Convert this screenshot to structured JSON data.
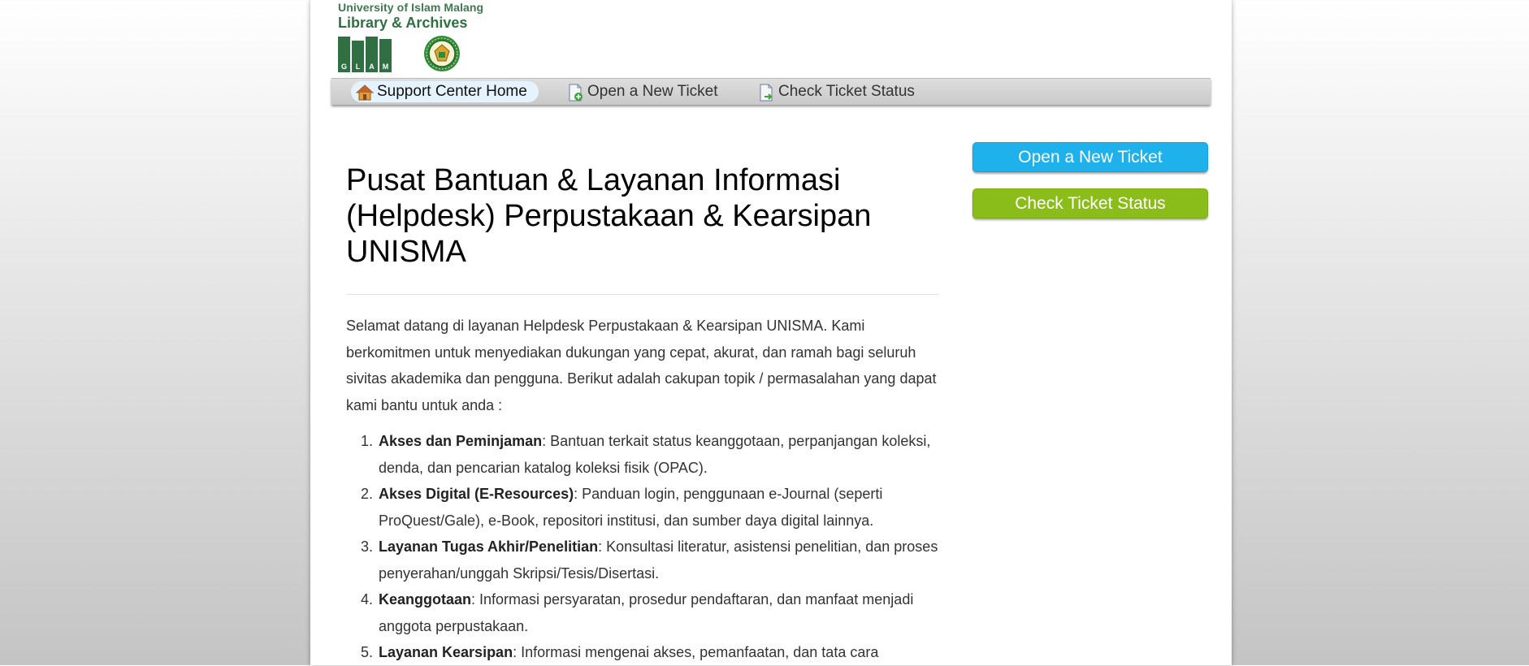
{
  "logo": {
    "line1": "University of Islam Malang",
    "line2": "Library & Archives",
    "glam_letters": [
      "G",
      "L",
      "A",
      "M"
    ],
    "brand_color": "#2f6f41"
  },
  "nav": {
    "items": [
      {
        "label": "Support Center Home",
        "icon": "home-icon",
        "active": true
      },
      {
        "label": "Open a New Ticket",
        "icon": "new-ticket-icon",
        "active": false
      },
      {
        "label": "Check Ticket Status",
        "icon": "ticket-status-icon",
        "active": false
      }
    ]
  },
  "main": {
    "title": "Pusat Bantuan & Layanan Informasi (Helpdesk) Perpustakaan & Kearsipan UNISMA",
    "intro": "Selamat datang di layanan Helpdesk Perpustakaan & Kearsipan UNISMA. Kami berkomitmen untuk menyediakan dukungan yang cepat, akurat, dan ramah bagi seluruh sivitas akademika dan pengguna. Berikut adalah cakupan topik / permasalahan yang dapat kami bantu untuk anda :",
    "topics": [
      {
        "term": "Akses dan Peminjaman",
        "desc": ": Bantuan terkait status keanggotaan, perpanjangan koleksi, denda, dan pencarian katalog koleksi fisik (OPAC)."
      },
      {
        "term": "Akses Digital (E-Resources)",
        "desc": ": Panduan login, penggunaan e-Journal (seperti ProQuest/Gale), e-Book, repositori institusi, dan sumber daya digital lainnya."
      },
      {
        "term": "Layanan Tugas Akhir/Penelitian",
        "desc": ": Konsultasi literatur, asistensi penelitian, dan proses penyerahan/unggah Skripsi/Tesis/Disertasi."
      },
      {
        "term": "Keanggotaan",
        "desc": ": Informasi persyaratan, prosedur pendaftaran, dan manfaat menjadi anggota perpustakaan."
      },
      {
        "term": "Layanan Kearsipan",
        "desc": ": Informasi mengenai akses, pemanfaatan, dan tata cara"
      }
    ]
  },
  "sidebar": {
    "open_ticket_label": "Open a New Ticket",
    "check_status_label": "Check Ticket Status",
    "open_color": "#1fb1ec",
    "check_color": "#8bbd1a"
  }
}
